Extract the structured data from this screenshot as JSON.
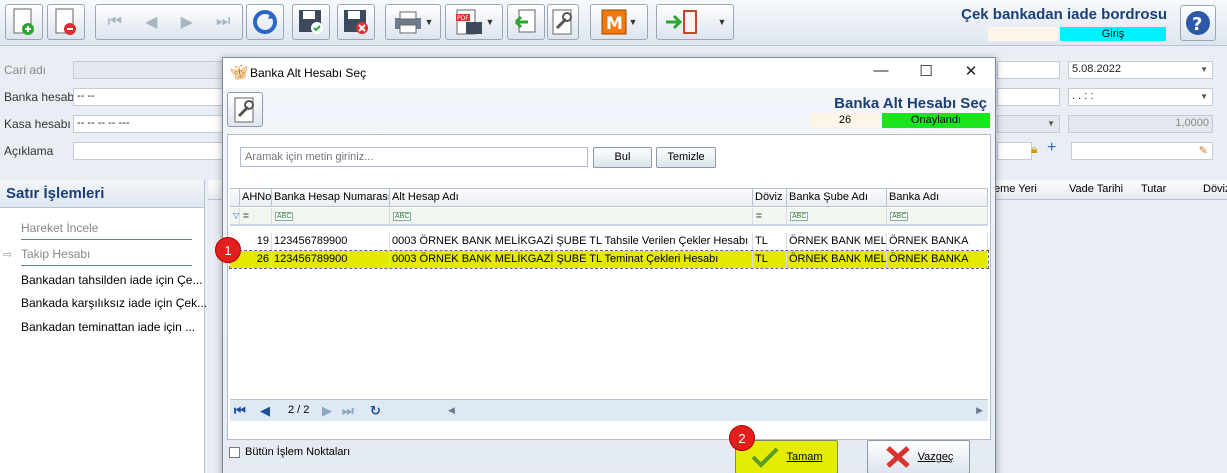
{
  "app": {
    "title": "Çek bankadan iade bordrosu",
    "mode": "Giriş",
    "colors": {
      "accent": "#1b3f78",
      "mode_bg": "#00f0ff",
      "selected_row": "#e3ea00",
      "approved": "#18e51b",
      "marker": "#e41d1d"
    }
  },
  "form": {
    "cari_label": "Cari adı",
    "bank_label": "Banka hesabı",
    "bank_value": "-- --",
    "kasa_label": "Kasa hesabı",
    "kasa_value": "-- -- -- -- ---",
    "desc_label": "Açıklama",
    "date_value": "5.08.2022",
    "time_value": ".  .     :  :",
    "rate_value": "1,0000"
  },
  "left_panel": {
    "title": "Satır İşlemleri",
    "items": [
      "Hareket İncele",
      "Takip Hesabı",
      "Bankadan tahsilden iade için Çe...",
      "Bankada karşılıksız iade için Çek...",
      "Bankadan teminattan iade için ..."
    ]
  },
  "bg_grid": {
    "columns": [
      "eme Yeri",
      "Vade Tarihi",
      "Tutar",
      "Döviz"
    ]
  },
  "dialog": {
    "window_title": "Banka Alt Hesabı Seç",
    "heading": "Banka Alt Hesabı Seç",
    "record_no": "26",
    "status": "Onaylandı",
    "search": {
      "placeholder": "Aramak için metin giriniz...",
      "find_label": "Bul",
      "clear_label": "Temizle"
    },
    "grid": {
      "columns": [
        "AHNo",
        "Banka Hesap Numarası",
        "Alt Hesap Adı",
        "Döviz",
        "Banka Şube Adı",
        "Banka Adı"
      ],
      "rows": [
        [
          "19",
          "123456789900",
          "0003 ÖRNEK BANK MELİKGAZİ ŞUBE TL Tahsile Verilen Çekler Hesabı",
          "TL",
          "ÖRNEK BANK MELİK",
          "ÖRNEK BANKA"
        ],
        [
          "26",
          "123456789900",
          "0003 ÖRNEK BANK MELİKGAZİ ŞUBE TL Teminat Çekleri Hesabı",
          "TL",
          "ÖRNEK BANK MELİK",
          "ÖRNEK BANKA"
        ]
      ],
      "selected_index": 1,
      "page": "2 / 2"
    },
    "all_points_label": "Bütün İşlem Noktaları",
    "ok_label": "Tamam",
    "cancel_label": "Vazgeç"
  },
  "markers": [
    "1",
    "2"
  ]
}
